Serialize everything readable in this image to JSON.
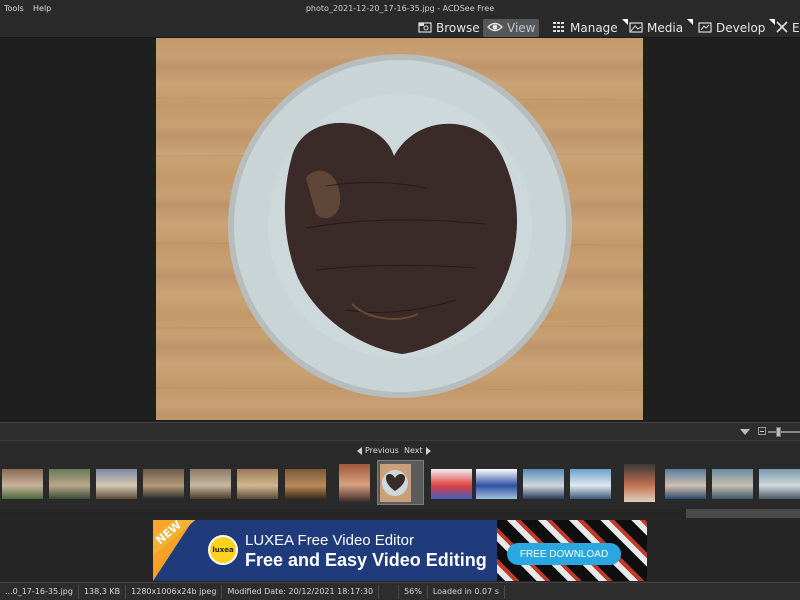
{
  "menu": {
    "items": [
      "Tools",
      "Help"
    ]
  },
  "window": {
    "title": "photo_2021-12-20_17-16-35.jpg - ACDSee Free"
  },
  "modes": [
    {
      "label": "Browse",
      "icon": "browse-icon"
    },
    {
      "label": "View",
      "icon": "eye-icon",
      "active": true
    },
    {
      "label": "Manage",
      "icon": "grid-icon"
    },
    {
      "label": "Media",
      "icon": "media-icon"
    },
    {
      "label": "Develop",
      "icon": "develop-icon"
    },
    {
      "label": "E",
      "icon": "edit-icon"
    }
  ],
  "filmstrip": {
    "previous_label": "Previous",
    "next_label": "Next",
    "selected_index": 8,
    "thumbnail_count": 17
  },
  "ad": {
    "badge": "NEW",
    "logo_text": "luxea",
    "line1": "LUXEA Free Video Editor",
    "line2": "Free and Easy Video Editing",
    "cta": "FREE DOWNLOAD"
  },
  "status": {
    "filename": "...0_17-16-35.jpg",
    "filesize": "138,3 KB",
    "dimensions": "1280x1006x24b jpeg",
    "modified": "Modified Date: 20/12/2021 18:17:30",
    "zoom": "56%",
    "loaded": "Loaded in 0.07 s"
  },
  "colors": {
    "accent_active": "#565656",
    "background": "#1e1e1e",
    "ad_cta": "#2aa7e0"
  }
}
